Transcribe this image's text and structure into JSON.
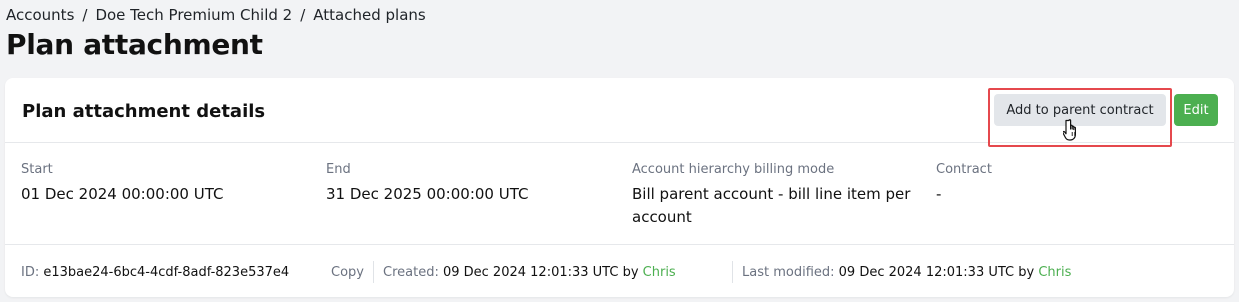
{
  "breadcrumb": {
    "items": [
      "Accounts",
      "Doe Tech Premium Child 2",
      "Attached plans"
    ],
    "separator": "/"
  },
  "page": {
    "title": "Plan attachment"
  },
  "card": {
    "title": "Plan attachment details",
    "actions": {
      "add_to_parent_label": "Add to parent contract",
      "edit_label": "Edit"
    },
    "fields": {
      "start": {
        "label": "Start",
        "value": "01 Dec 2024 00:00:00 UTC"
      },
      "end": {
        "label": "End",
        "value": "31 Dec 2025 00:00:00 UTC"
      },
      "billing_mode": {
        "label": "Account hierarchy billing mode",
        "value": "Bill parent account - bill line item per account"
      },
      "contract": {
        "label": "Contract",
        "value": "-"
      }
    },
    "footer": {
      "id_label": "ID:",
      "id_value": "e13bae24-6bc4-4cdf-8adf-823e537e4",
      "copy_label": "Copy",
      "created_label": "Created:",
      "created_value": "09 Dec 2024 12:01:33 UTC by",
      "created_by": "Chris",
      "modified_label": "Last modified:",
      "modified_value": "09 Dec 2024 12:01:33 UTC by",
      "modified_by": "Chris"
    }
  },
  "colors": {
    "accent_green": "#4caf50",
    "highlight_red": "#e5484d",
    "secondary_button": "#e3e6ea"
  },
  "icons": {
    "cursor": "hand-pointer-icon"
  }
}
